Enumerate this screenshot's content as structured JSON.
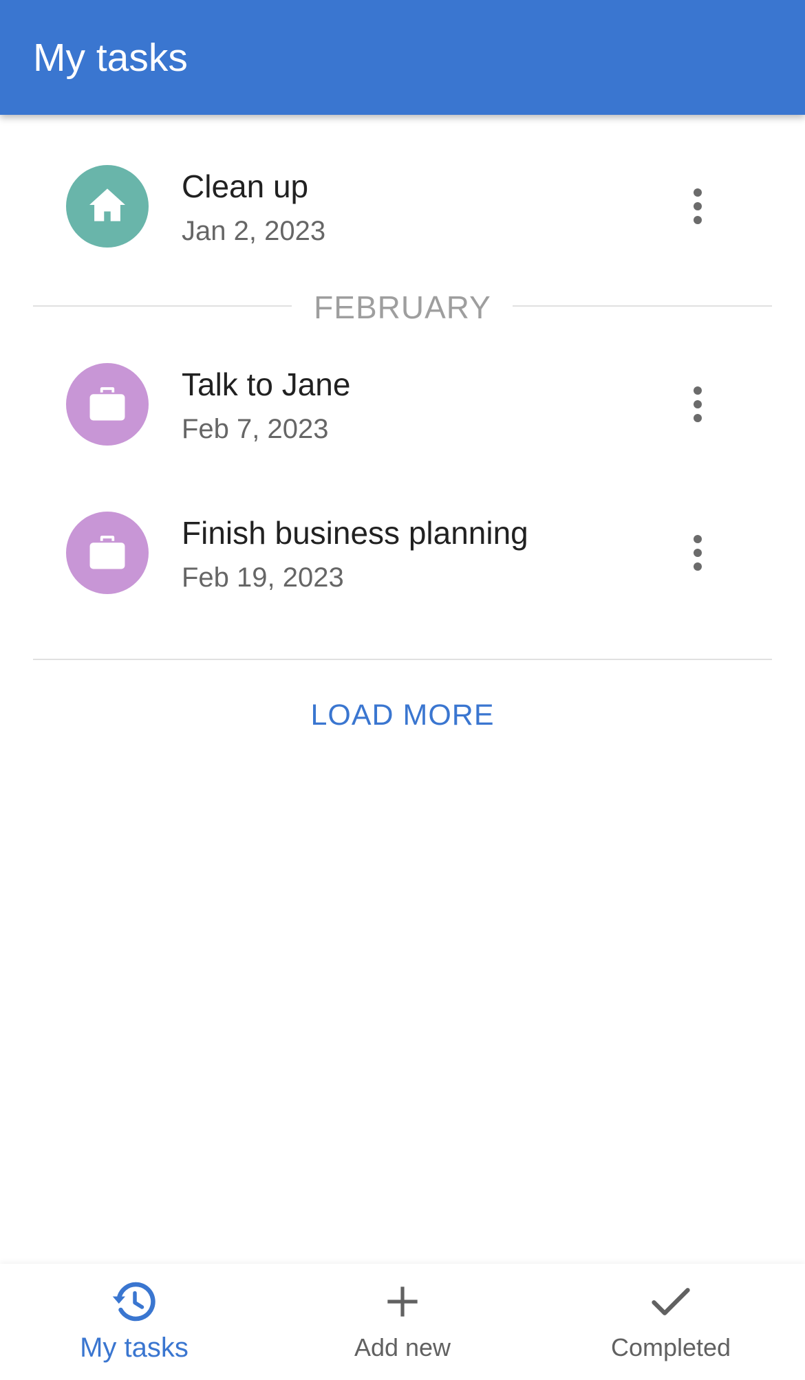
{
  "app_bar": {
    "title": "My tasks"
  },
  "colors": {
    "primary": "#3a76d0",
    "home_avatar": "#69b5aa",
    "work_avatar": "#c896d6",
    "divider": "#e0e0e0",
    "secondary_text": "#666666",
    "section_label": "#9e9e9e"
  },
  "tasks_before_section": [
    {
      "title": "Clean up",
      "date": "Jan 2, 2023",
      "icon": "home-icon",
      "avatar_color": "#69b5aa"
    }
  ],
  "section": {
    "label": "FEBRUARY"
  },
  "tasks_february": [
    {
      "title": "Talk to Jane",
      "date": "Feb 7, 2023",
      "icon": "briefcase-icon",
      "avatar_color": "#c896d6"
    },
    {
      "title": "Finish business planning",
      "date": "Feb 19, 2023",
      "icon": "briefcase-icon",
      "avatar_color": "#c896d6"
    }
  ],
  "load_more_label": "LOAD MORE",
  "bottom_nav": {
    "items": [
      {
        "label": "My tasks",
        "icon": "history-icon",
        "active": true
      },
      {
        "label": "Add new",
        "icon": "plus-icon",
        "active": false
      },
      {
        "label": "Completed",
        "icon": "check-icon",
        "active": false
      }
    ]
  }
}
